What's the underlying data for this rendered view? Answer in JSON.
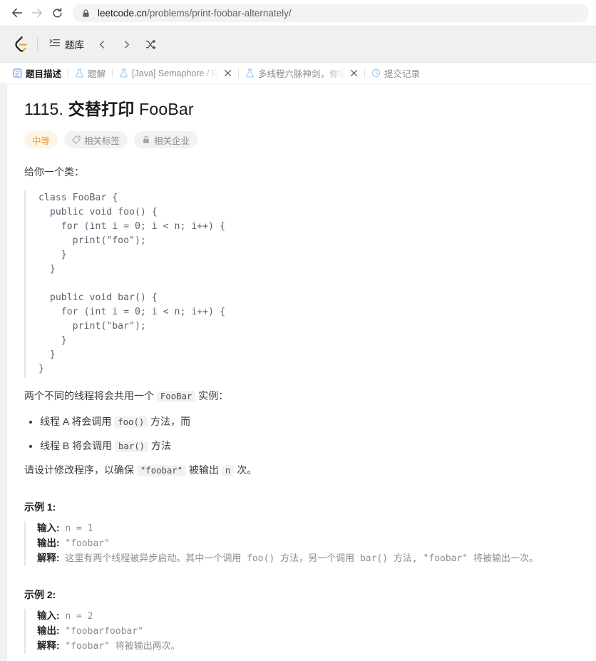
{
  "browser": {
    "back_icon": "back-arrow-icon",
    "forward_icon": "forward-arrow-icon",
    "reload_icon": "reload-icon",
    "lock_icon": "lock-icon",
    "url_host": "leetcode.cn",
    "url_path": "/problems/print-foobar-alternately/"
  },
  "app_header": {
    "logo": "leetcode-logo",
    "problemset_icon": "list-icon",
    "problemset_label": "题库",
    "prev_icon": "chevron-left-icon",
    "next_icon": "chevron-right-icon",
    "shuffle_icon": "shuffle-icon"
  },
  "tabs": [
    {
      "icon": "description-icon",
      "label": "题目描述",
      "active": true,
      "closable": false
    },
    {
      "icon": "flask-icon",
      "label": "题解",
      "active": false,
      "closable": false
    },
    {
      "icon": "flask-icon",
      "label": "[Java] Semaphore / Reen",
      "active": false,
      "closable": true,
      "truncated": true
    },
    {
      "icon": "flask-icon",
      "label": "多线程六脉神剑，你学废",
      "active": false,
      "closable": true,
      "truncated": true
    },
    {
      "icon": "clock-icon",
      "label": "提交记录",
      "active": false,
      "closable": false
    }
  ],
  "problem": {
    "number": "1115. ",
    "title_cjk": "交替打印",
    "title_latin": " FooBar",
    "badges": [
      {
        "icon": "",
        "label": "中等",
        "kind": "difficulty"
      },
      {
        "icon": "tag-icon",
        "label": "相关标签",
        "kind": "plain"
      },
      {
        "icon": "building-icon",
        "label": "相关企业",
        "kind": "plain"
      }
    ],
    "intro": "给你一个类：",
    "code": "class FooBar {\n  public void foo() {\n    for (int i = 0; i < n; i++) {\n      print(\"foo\");\n    }\n  }\n\n  public void bar() {\n    for (int i = 0; i < n; i++) {\n      print(\"bar\");\n    }\n  }\n}",
    "shared_pre": "两个不同的线程将会共用一个 ",
    "shared_code": "FooBar",
    "shared_post": " 实例：",
    "bullets": [
      {
        "pre": "线程 A 将会调用 ",
        "code": "foo()",
        "post": " 方法，而"
      },
      {
        "pre": "线程 B 将会调用 ",
        "code": "bar()",
        "post": " 方法"
      }
    ],
    "goal_pre": "请设计修改程序，以确保 ",
    "goal_code1": "\"foobar\"",
    "goal_mid": " 被输出 ",
    "goal_code2": "n",
    "goal_post": " 次。"
  },
  "examples": [
    {
      "title": "示例 1:",
      "input_label": "输入:",
      "input_value": " n = 1",
      "output_label": "输出:",
      "output_value": " \"foobar\"",
      "explain_label": "解释:",
      "explain_value": " 这里有两个线程被异步启动。其中一个调用 foo() 方法，另一个调用 bar() 方法, \"foobar\" 将被输出一次。"
    },
    {
      "title": "示例 2:",
      "input_label": "输入:",
      "input_value": " n = 2",
      "output_label": "输出:",
      "output_value": " \"foobarfoobar\"",
      "explain_label": "解释:",
      "explain_value": " \"foobar\" 将被输出两次。"
    }
  ],
  "colors": {
    "difficulty_orange": "#f0a029",
    "tab_active": "#1a1a1a",
    "tab_inactive": "#8c8c8c",
    "accent_blue": "#4d9bf5"
  }
}
